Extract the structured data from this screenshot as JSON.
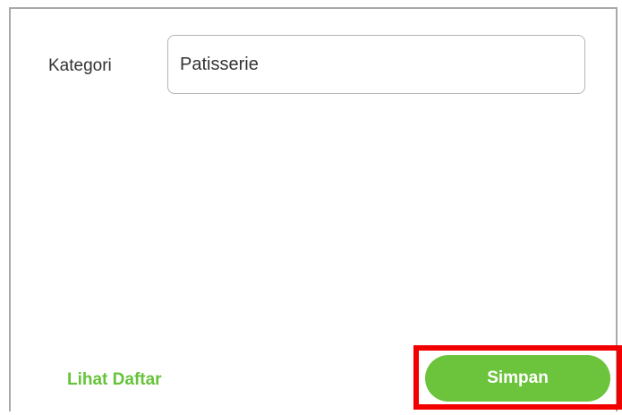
{
  "form": {
    "category_label": "Kategori",
    "category_value": "Patisserie"
  },
  "footer": {
    "view_list_label": "Lihat Daftar",
    "save_label": "Simpan"
  },
  "colors": {
    "accent": "#6cc33c",
    "link": "#66c33a",
    "highlight": "#f20000"
  }
}
